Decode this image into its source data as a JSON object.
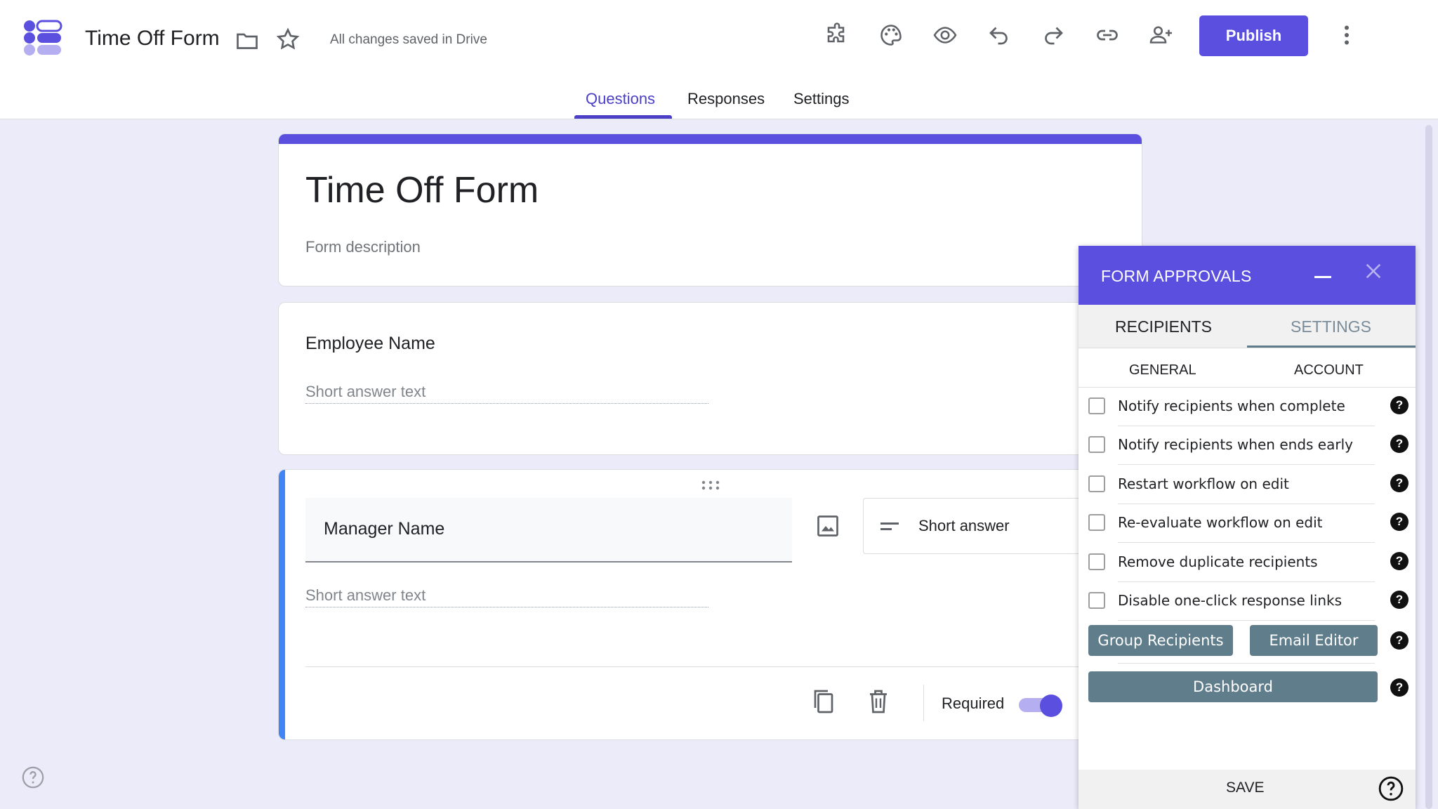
{
  "header": {
    "doc_title": "Time Off Form",
    "save_status": "All changes saved in Drive",
    "publish_label": "Publish",
    "icons": [
      "folder-icon",
      "star-icon",
      "addon-icon",
      "palette-icon",
      "preview-icon",
      "undo-icon",
      "redo-icon",
      "link-icon",
      "add-collaborator-icon",
      "more-vert-icon"
    ]
  },
  "tabs": [
    {
      "label": "Questions",
      "active": true
    },
    {
      "label": "Responses",
      "active": false
    },
    {
      "label": "Settings",
      "active": false
    }
  ],
  "form": {
    "title": "Time Off Form",
    "description_placeholder": "Form description",
    "questions": [
      {
        "label": "Employee Name",
        "answer_placeholder": "Short answer text"
      },
      {
        "label": "Manager Name",
        "answer_placeholder": "Short answer text",
        "type": "Short answer",
        "required_label": "Required",
        "required": true
      }
    ]
  },
  "panel": {
    "title": "FORM APPROVALS",
    "tabs": [
      {
        "label": "RECIPIENTS"
      },
      {
        "label": "SETTINGS",
        "active": true
      }
    ],
    "subtabs": [
      {
        "label": "GENERAL",
        "active": true
      },
      {
        "label": "ACCOUNT"
      }
    ],
    "options": [
      {
        "label": "Notify recipients when complete",
        "checked": false
      },
      {
        "label": "Notify recipients when ends early",
        "checked": false
      },
      {
        "label": "Restart workflow on edit",
        "checked": false
      },
      {
        "label": "Re-evaluate workflow on edit",
        "checked": false
      },
      {
        "label": "Remove duplicate recipients",
        "checked": false
      },
      {
        "label": "Disable one-click response links",
        "checked": false
      }
    ],
    "buttons": {
      "group_recipients": "Group Recipients",
      "email_editor": "Email Editor",
      "dashboard": "Dashboard"
    },
    "help_glyph": "?",
    "save_label": "SAVE"
  },
  "colors": {
    "accent": "#5b4fe0",
    "background": "#ecebfa",
    "panel_button": "#607d8b",
    "question_focus_bar": "#4285f4"
  }
}
